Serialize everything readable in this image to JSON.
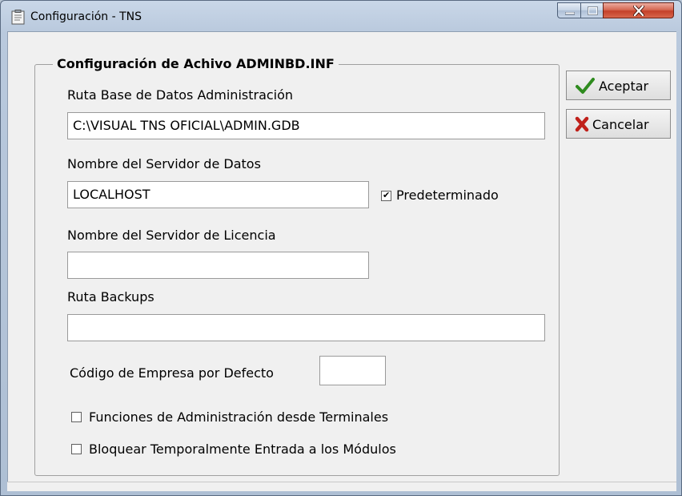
{
  "window": {
    "title": "Configuración - TNS",
    "controls": {
      "minimize": "minimize",
      "maximize": "maximize",
      "close": "close"
    }
  },
  "group": {
    "legend": "Configuración de Achivo ADMINBD.INF"
  },
  "form": {
    "ruta_bd_label": "Ruta Base de Datos Administración",
    "ruta_bd_value": "C:\\VISUAL TNS OFICIAL\\ADMIN.GDB",
    "servidor_datos_label": "Nombre del Servidor de Datos",
    "servidor_datos_value": "LOCALHOST",
    "predeterminado_label": "Predeterminado",
    "predeterminado_checked": true,
    "servidor_licencia_label": "Nombre del Servidor de Licencia",
    "servidor_licencia_value": "",
    "ruta_backups_label": "Ruta Backups",
    "ruta_backups_value": "",
    "codigo_empresa_label": "Código de Empresa por Defecto",
    "codigo_empresa_value": "",
    "funciones_admin_label": "Funciones de Administración desde Terminales",
    "funciones_admin_checked": false,
    "bloquear_label": "Bloquear Temporalmente Entrada a los Módulos",
    "bloquear_checked": false
  },
  "buttons": {
    "aceptar": "Aceptar",
    "cancelar": "Cancelar"
  },
  "colors": {
    "accept_icon": "#2e8b1e",
    "cancel_icon": "#c0201a"
  }
}
